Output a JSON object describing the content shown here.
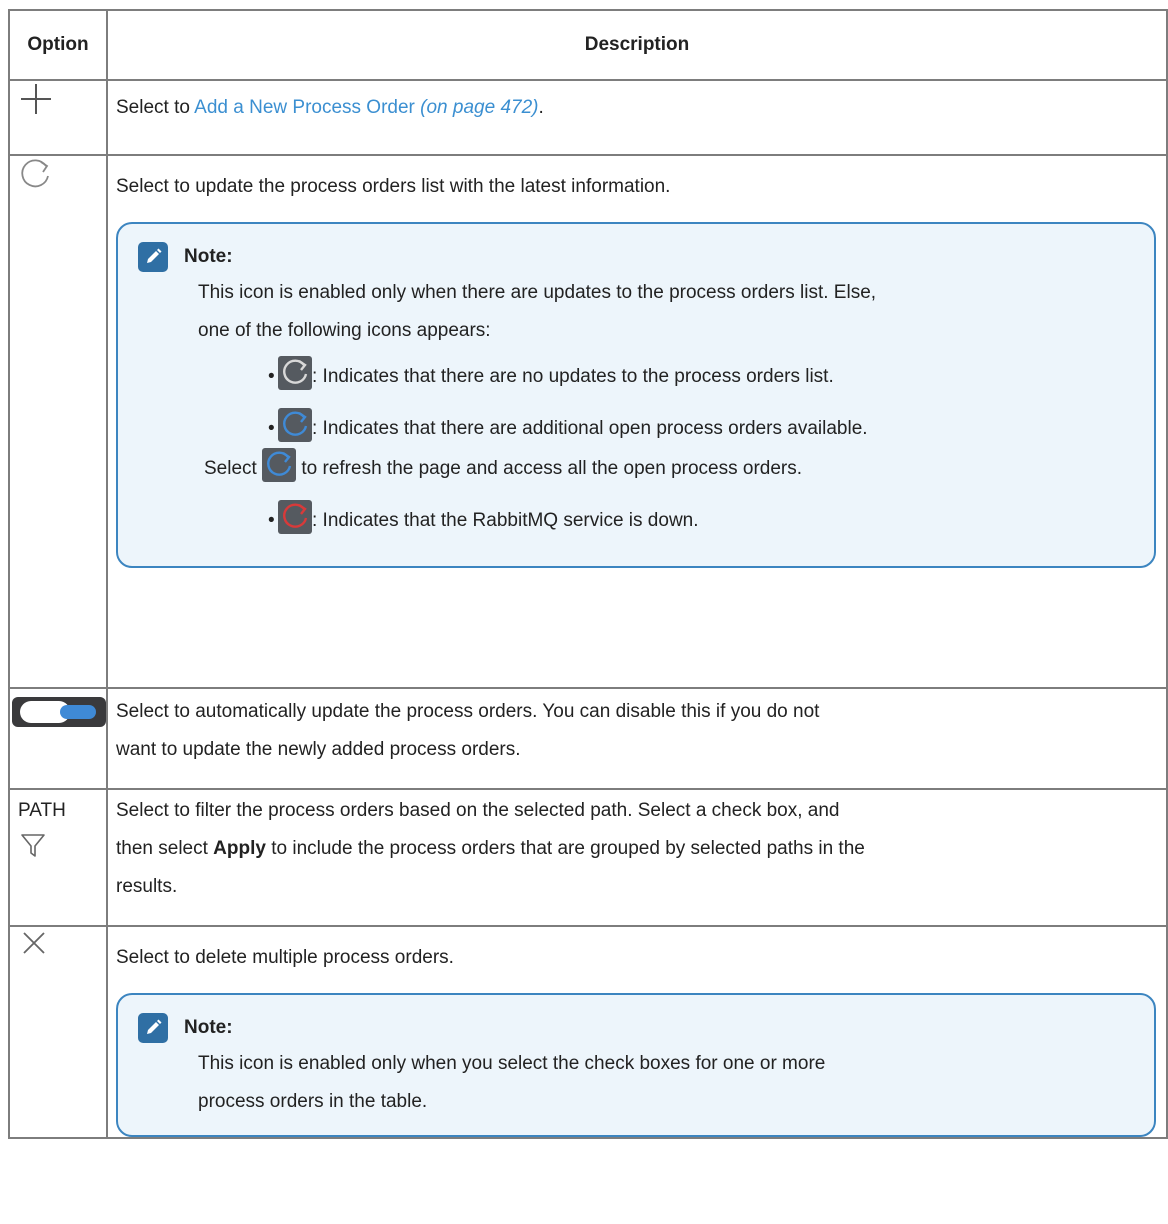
{
  "headers": {
    "option": "Option",
    "description": "Description"
  },
  "rows": {
    "add": {
      "icon": "plus-icon",
      "prefix": "Select to ",
      "link": "Add a New Process Order",
      "ref": "(on page 472)",
      "suffix": "."
    },
    "refresh": {
      "icon": "refresh-icon",
      "text": "Select to update the process orders list with the latest information.",
      "note_title": "Note:",
      "note_line1": "This icon is enabled only when there are updates to the process orders list. Else,",
      "note_line2": "one of the following icons appears:",
      "states": [
        {
          "icon": "refresh-gray-icon",
          "color": "#d8d8d8",
          "text": ": Indicates that there are no updates to the process orders list."
        },
        {
          "icon": "refresh-blue-icon",
          "color": "#3f8ad6",
          "text": ": Indicates that there are additional open process orders available."
        },
        {
          "icon": "refresh-red-icon",
          "color": "#d83a3a",
          "text": ": Indicates that the RabbitMQ service is down."
        }
      ],
      "select_prefix": "Select",
      "select_suffix": "to refresh the page and access all the open process orders."
    },
    "auto": {
      "icon": "toggle-switch-icon",
      "line1": "Select to automatically update the process orders. You can disable this if you do not",
      "line2": "want to update the newly added process orders."
    },
    "path": {
      "label": "PATH",
      "icon": "filter-icon",
      "line1": "Select to filter the process orders based on the selected path. Select a check box, and",
      "line2_prefix": "then select ",
      "line2_bold": "Apply",
      "line2_suffix": " to include the process orders that are grouped by selected paths in the",
      "line3": "results."
    },
    "delete": {
      "icon": "close-icon",
      "text": "Select to delete multiple process orders.",
      "note_title": "Note:",
      "note_line1": "This icon is enabled only when you select the check boxes for one or more",
      "note_line2": "process orders in the table."
    }
  },
  "colors": {
    "link": "#3b8fd1",
    "note_border": "#3c85c0",
    "note_bg": "#edf5fb",
    "table_border": "#7d7d7d"
  }
}
